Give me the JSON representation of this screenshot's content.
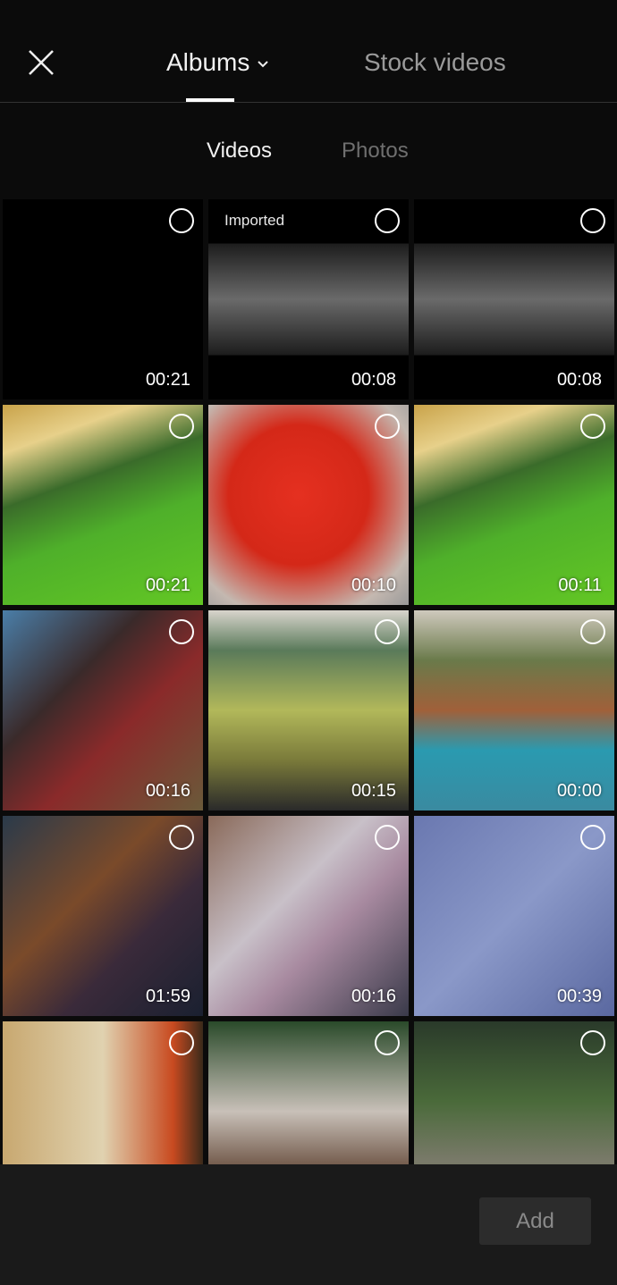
{
  "header": {
    "close_icon": "close-icon",
    "tabs": [
      {
        "label": "Albums",
        "active": true,
        "icon": "chevron-down-icon"
      },
      {
        "label": "Stock videos",
        "active": false
      }
    ]
  },
  "subtabs": [
    {
      "label": "Videos",
      "active": true
    },
    {
      "label": "Photos",
      "active": false
    }
  ],
  "media": [
    {
      "duration": "00:21",
      "badge": ""
    },
    {
      "duration": "00:08",
      "badge": "Imported"
    },
    {
      "duration": "00:08",
      "badge": ""
    },
    {
      "duration": "00:21",
      "badge": ""
    },
    {
      "duration": "00:10",
      "badge": ""
    },
    {
      "duration": "00:11",
      "badge": ""
    },
    {
      "duration": "00:16",
      "badge": ""
    },
    {
      "duration": "00:15",
      "badge": ""
    },
    {
      "duration": "00:00",
      "badge": ""
    },
    {
      "duration": "01:59",
      "badge": ""
    },
    {
      "duration": "00:16",
      "badge": ""
    },
    {
      "duration": "00:39",
      "badge": ""
    },
    {
      "duration": "",
      "badge": ""
    },
    {
      "duration": "",
      "badge": ""
    },
    {
      "duration": "",
      "badge": ""
    }
  ],
  "footer": {
    "add_label": "Add"
  }
}
